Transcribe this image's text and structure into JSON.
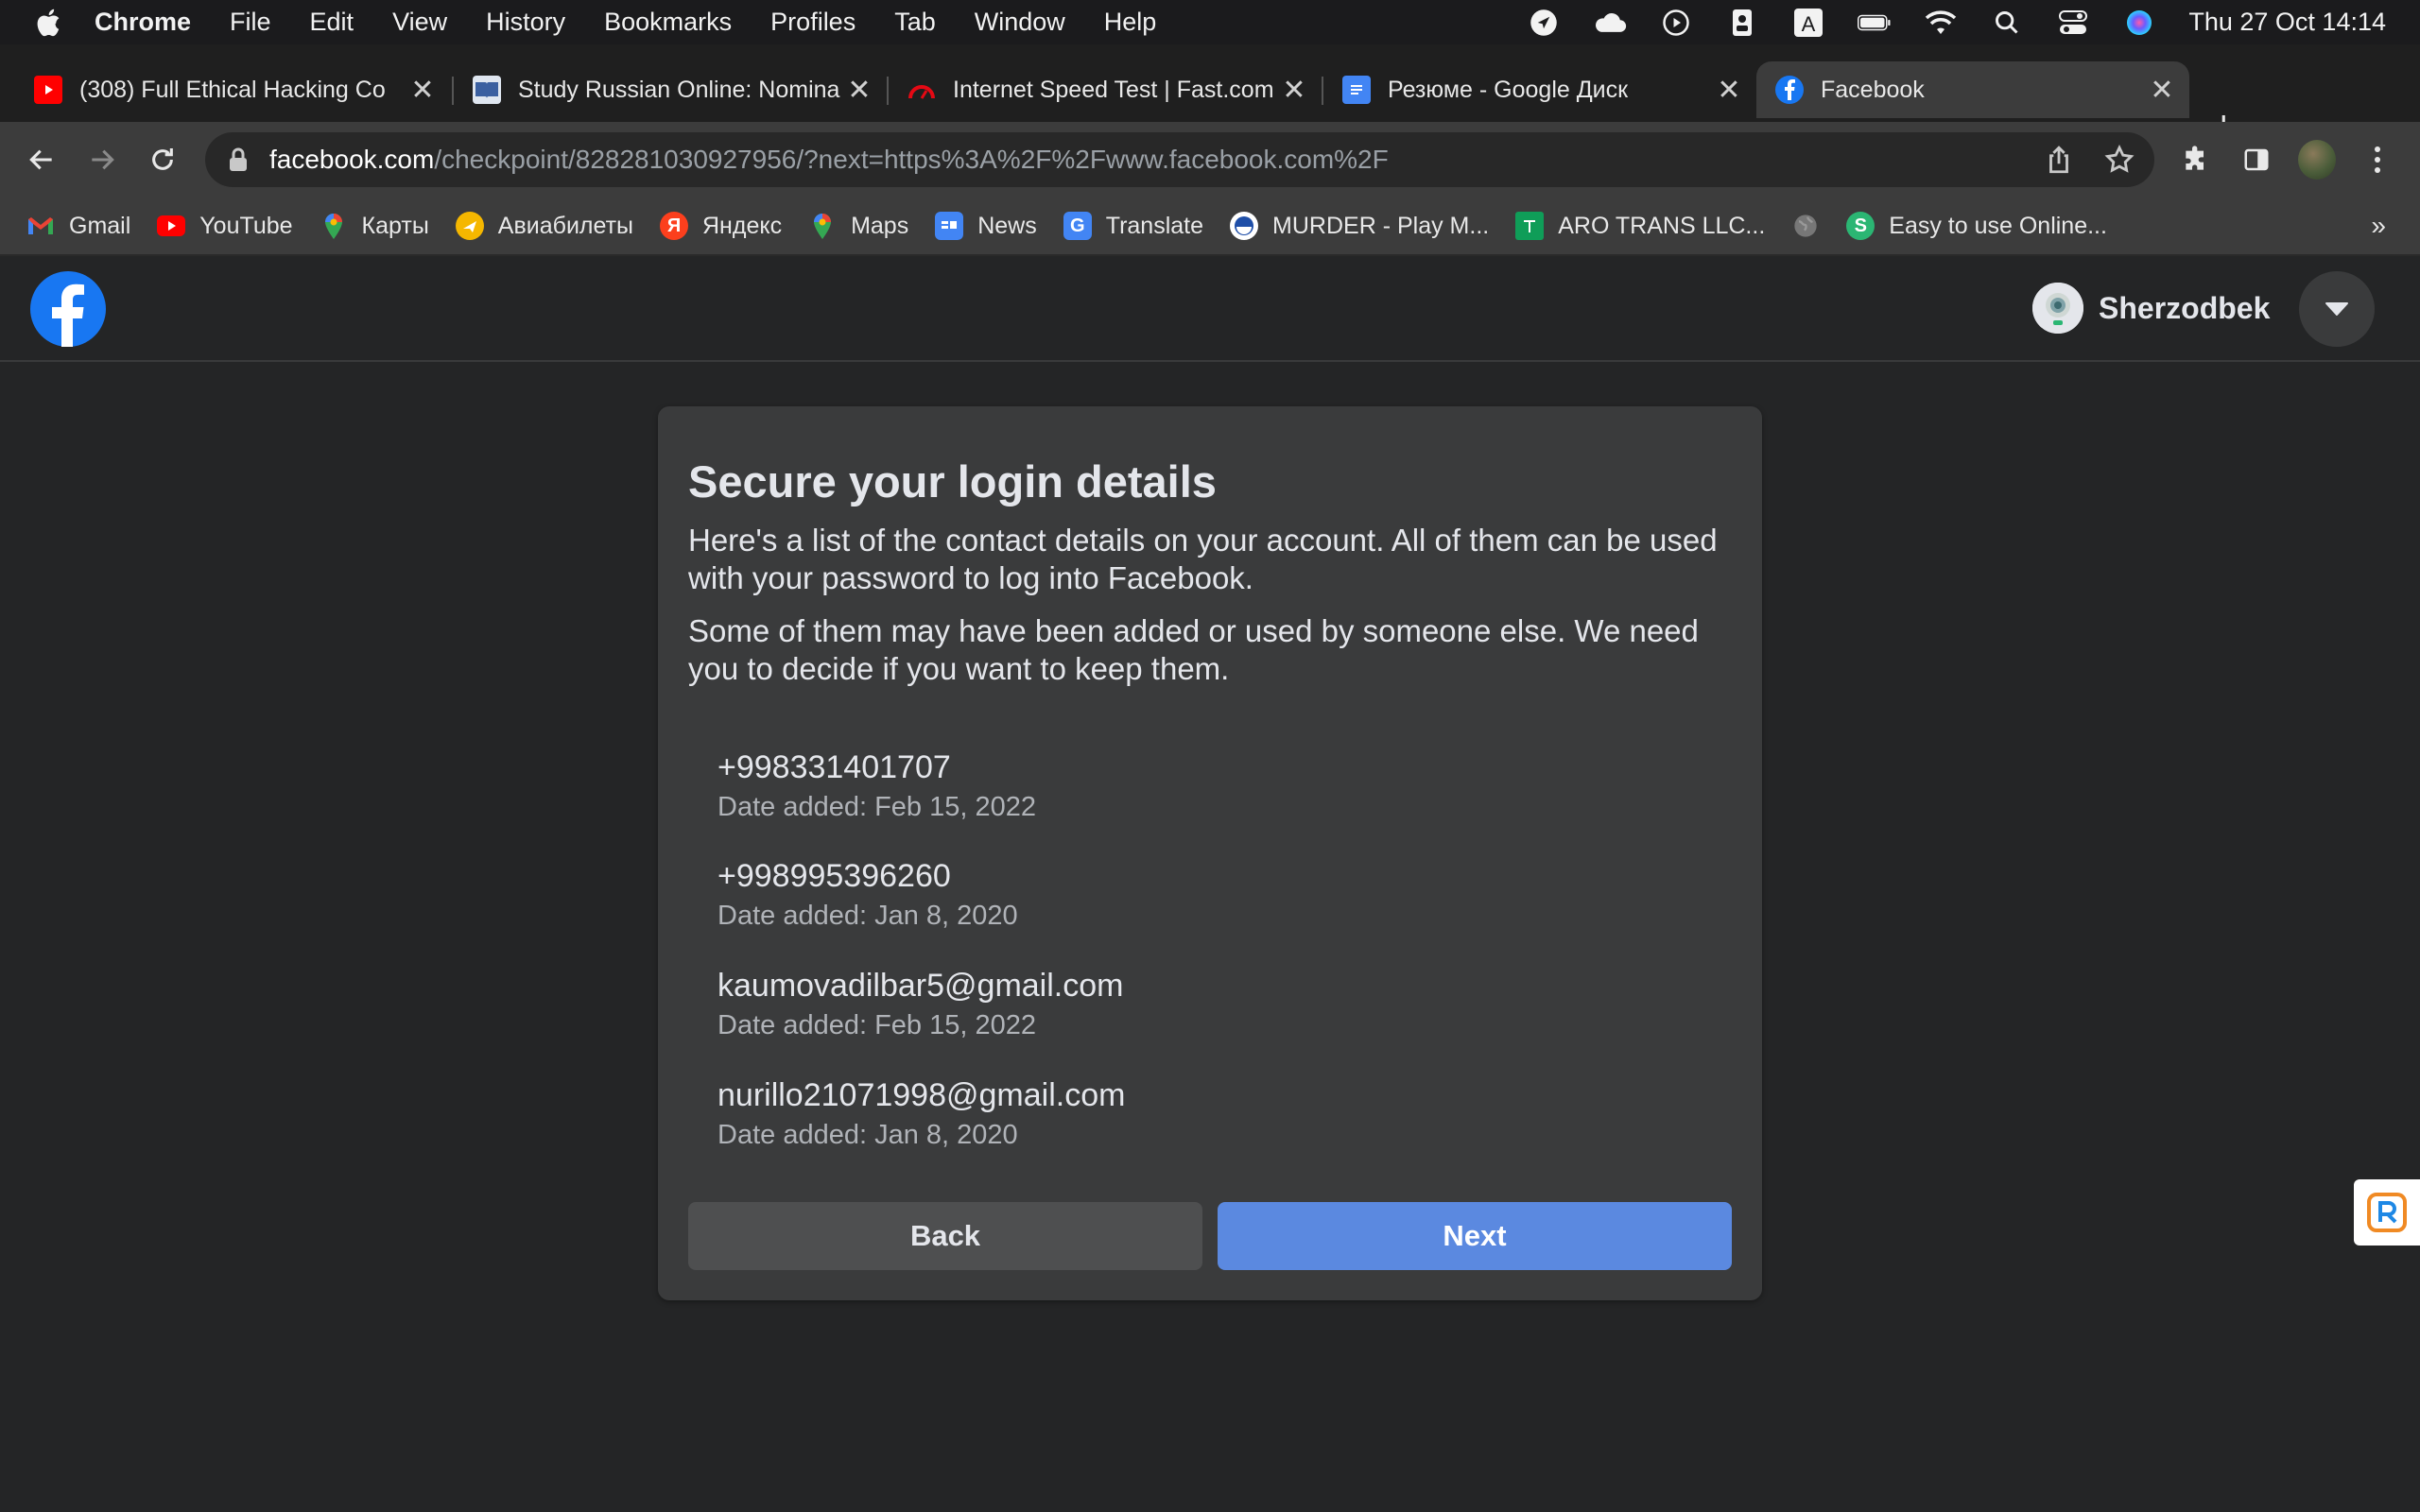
{
  "menubar": {
    "items": [
      "Chrome",
      "File",
      "Edit",
      "View",
      "History",
      "Bookmarks",
      "Profiles",
      "Tab",
      "Window",
      "Help"
    ],
    "clock": "Thu 27 Oct  14:14"
  },
  "tabs": [
    {
      "title": "(308) Full Ethical Hacking Co",
      "icon": "youtube-icon",
      "active": false
    },
    {
      "title": "Study Russian Online: Nomina",
      "icon": "book-icon",
      "active": false
    },
    {
      "title": "Internet Speed Test | Fast.com",
      "icon": "speedometer-icon",
      "active": false
    },
    {
      "title": "Резюме - Google Диск",
      "icon": "google-docs-icon",
      "active": false
    },
    {
      "title": "Facebook",
      "icon": "facebook-icon",
      "active": true
    }
  ],
  "address": {
    "host": "facebook.com",
    "path": "/checkpoint/828281030927956/?next=https%3A%2F%2Fwww.facebook.com%2F"
  },
  "bookmarks": [
    {
      "label": "Gmail",
      "icon": "gmail-icon"
    },
    {
      "label": "YouTube",
      "icon": "youtube-icon"
    },
    {
      "label": "Карты",
      "icon": "maps-pin-icon"
    },
    {
      "label": "Авиабилеты",
      "icon": "aviasales-icon"
    },
    {
      "label": "Яндекс",
      "icon": "yandex-icon"
    },
    {
      "label": "Maps",
      "icon": "maps-pin-icon"
    },
    {
      "label": "News",
      "icon": "google-news-icon"
    },
    {
      "label": "Translate",
      "icon": "translate-icon"
    },
    {
      "label": "MURDER - Play M...",
      "icon": "murder-game-icon"
    },
    {
      "label": "ARO TRANS LLC...",
      "icon": "sheets-icon"
    },
    {
      "label": "",
      "icon": "globe-icon"
    },
    {
      "label": "Easy to use Online...",
      "icon": "s-logo-icon"
    }
  ],
  "fb": {
    "profile_name": "Sherzodbek"
  },
  "card": {
    "title": "Secure your login details",
    "para1": "Here's a list of the contact details on your account. All of them can be used with your password to log into Facebook.",
    "para2": "Some of them may have been added or used by someone else. We need you to decide if you want to keep them.",
    "contacts": [
      {
        "value": "+998331401707",
        "date": "Date added: Feb 15, 2022"
      },
      {
        "value": "+998995396260",
        "date": "Date added: Jan 8, 2020"
      },
      {
        "value": "kaumovadilbar5@gmail.com",
        "date": "Date added: Feb 15, 2022"
      },
      {
        "value": "nurillo21071998@gmail.com",
        "date": "Date added: Jan 8, 2020"
      }
    ],
    "back_label": "Back",
    "next_label": "Next"
  },
  "colors": {
    "fb_blue": "#1877f2",
    "next_button": "#5b89e0",
    "page_bg": "#242526",
    "card_bg": "#3a3b3c"
  }
}
